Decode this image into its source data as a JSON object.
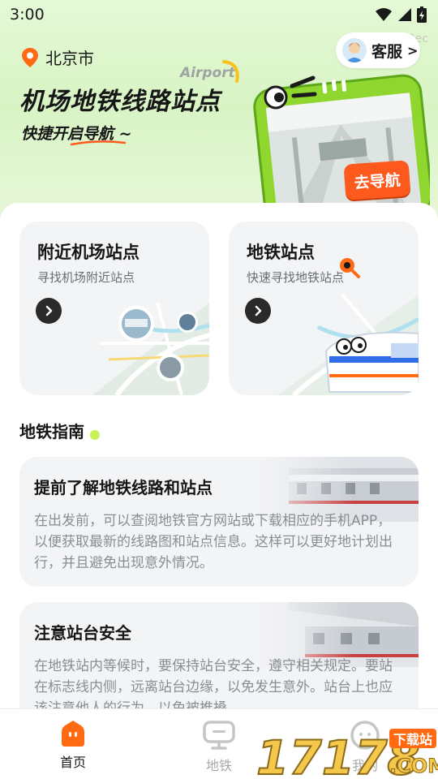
{
  "status_bar": {
    "time": "3:00"
  },
  "watermark_id": "ID:1330ec",
  "location": {
    "city": "北京市"
  },
  "customer_service": {
    "label": "客服",
    "chevron": ">"
  },
  "hero": {
    "airport_word": "Airport",
    "title": "机场地铁线路站点",
    "subtitle": "快捷开启导航 ~",
    "nav_badge": "去导航"
  },
  "entry_cards": [
    {
      "title": "附近机场站点",
      "desc": "寻找机场附近站点"
    },
    {
      "title": "地铁站点",
      "desc": "快速寻找地铁站点"
    }
  ],
  "guide": {
    "section_title": "地铁指南",
    "cards": [
      {
        "title": "提前了解地铁线路和站点",
        "body": "在出发前，可以查阅地铁官方网站或下载相应的手机APP，以便获取最新的线路图和站点信息。这样可以更好地计划出行，并且避免出现意外情况。"
      },
      {
        "title": "注意站台安全",
        "body": "在地铁站内等候时，要保持站台安全，遵守相关规定。要站在标志线内侧，远离站台边缘，以免发生意外。站台上也应该注意他人的行为，以免被推搡"
      }
    ]
  },
  "tabbar": {
    "tabs": [
      {
        "label": "首页",
        "active": true,
        "icon": "home-icon"
      },
      {
        "label": "地铁",
        "active": false,
        "icon": "metro-icon"
      },
      {
        "label": "我的",
        "active": false,
        "icon": "profile-icon"
      }
    ]
  },
  "brand_watermark": {
    "number": "17178",
    "tag": "下载站",
    "suffix": ".COM"
  },
  "colors": {
    "accent_orange": "#ff6a13",
    "hero_green": "#d8f4c4",
    "frame_green": "#8fd62f",
    "dark_button": "#2a2a2a"
  }
}
